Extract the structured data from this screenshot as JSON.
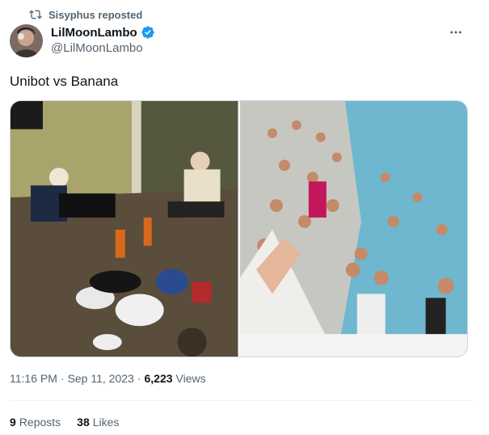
{
  "repost": {
    "label": "Sisyphus reposted",
    "icon": "repost-icon"
  },
  "author": {
    "display_name": "LilMoonLambo",
    "handle": "@LilMoonLambo",
    "verified": true,
    "verified_color": "#1d9bf0"
  },
  "tweet": {
    "text": "Unibot vs Banana"
  },
  "media": [
    {
      "description": "unibot-room-photo"
    },
    {
      "description": "banana-pool-party-photo"
    }
  ],
  "meta": {
    "time": "11:16 PM",
    "date": "Sep 11, 2023",
    "views_count": "6,223",
    "views_label": "Views"
  },
  "stats": {
    "reposts_count": "9",
    "reposts_label": "Reposts",
    "likes_count": "38",
    "likes_label": "Likes"
  },
  "colors": {
    "secondary_text": "#536471",
    "primary_text": "#0f1419",
    "accent": "#1d9bf0"
  }
}
